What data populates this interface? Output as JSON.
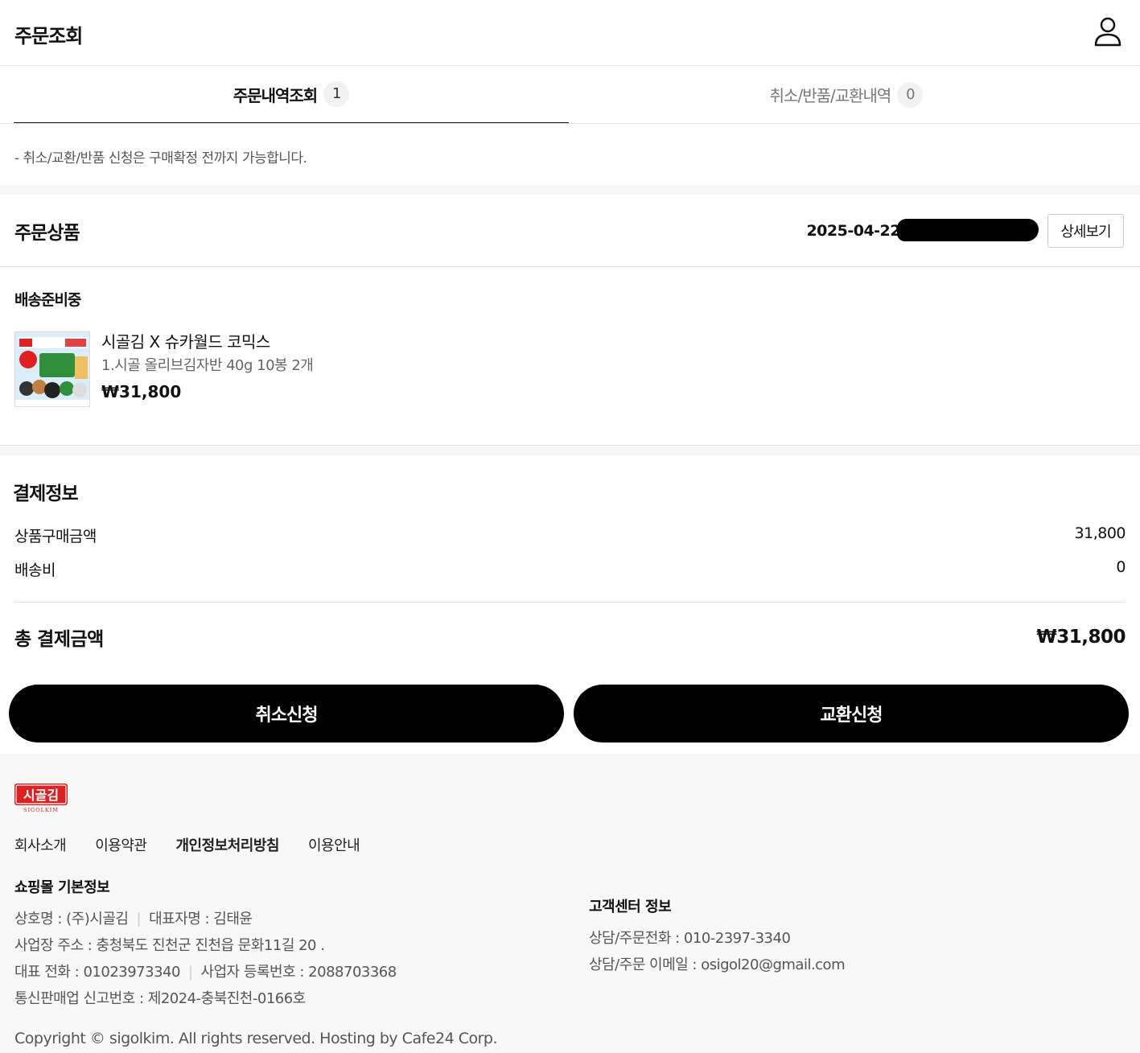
{
  "header": {
    "title": "주문조회",
    "user_icon": "user-icon"
  },
  "tabs": [
    {
      "label": "주문내역조회",
      "count": "1"
    },
    {
      "label": "취소/반품/교환내역",
      "count": "0"
    }
  ],
  "notice": "- 취소/교환/반품 신청은 구매확정 전까지 가능합니다.",
  "order": {
    "section_title": "주문상품",
    "date": "2025-04-22",
    "detail_button": "상세보기",
    "status": "배송준비중",
    "product": {
      "name": "시골김 X 슈카월드 코믹스",
      "option": "1.시골 올리브김자반 40g 10봉 2개",
      "price": "₩31,800"
    }
  },
  "payment": {
    "title": "결제정보",
    "rows": [
      {
        "label": "상품구매금액",
        "value": "31,800"
      },
      {
        "label": "배송비",
        "value": "0"
      }
    ],
    "total_label": "총 결제금액",
    "total_value": "₩31,800"
  },
  "actions": {
    "cancel": "취소신청",
    "exchange": "교환신청"
  },
  "footer": {
    "logo_text": "시골김",
    "logo_sub": "SIGOLKIM",
    "links": [
      "회사소개",
      "이용약관",
      "개인정보처리방침",
      "이용안내"
    ],
    "shop_title": "쇼핑몰 기본정보",
    "shop_name": "상호명 : (주)시골김",
    "ceo": "대표자명 : 김태윤",
    "address": "사업장 주소 : 충청북도 진천군 진천읍 문화11길 20 .",
    "phone": "대표 전화 : 01023973340",
    "biz_no": "사업자 등록번호 : 2088703368",
    "ecommerce_no": "통신판매업 신고번호 : 제2024-충북진천-0166호",
    "cs_title": "고객센터 정보",
    "cs_phone": "상담/주문전화 : 010-2397-3340",
    "cs_email": "상담/주문 이메일 : osigol20@gmail.com",
    "copyright": "Copyright © sigolkim. All rights reserved. Hosting by Cafe24 Corp."
  },
  "colors": {
    "accent": "#000000",
    "logo_red": "#e02020",
    "footer_bg": "#f8f8f8"
  }
}
